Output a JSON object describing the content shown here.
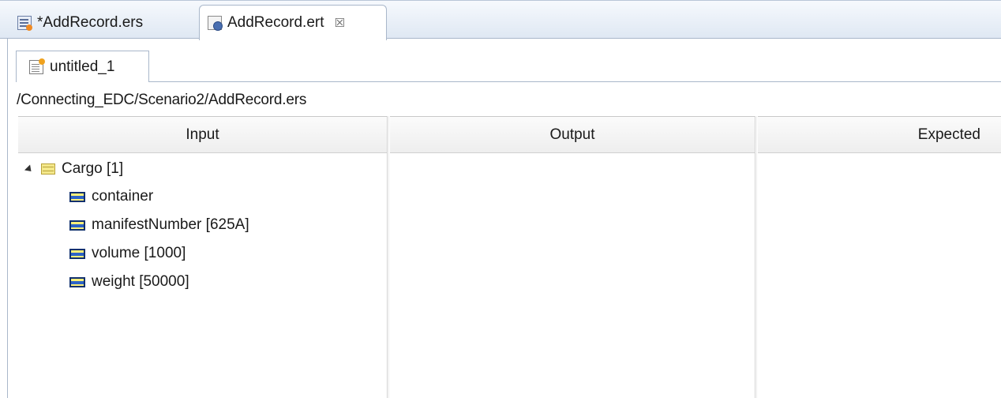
{
  "editor_tabs": [
    {
      "label": "*AddRecord.ers",
      "icon": "ers-file-icon",
      "active": false
    },
    {
      "label": "AddRecord.ert",
      "icon": "ert-file-icon",
      "active": true,
      "close_symbol": "☒"
    }
  ],
  "sub_tab": {
    "label": "untitled_1",
    "icon": "test-document-icon"
  },
  "path": "/Connecting_EDC/Scenario2/AddRecord.ers",
  "columns": {
    "input": "Input",
    "output": "Output",
    "expected": "Expected"
  },
  "tree": {
    "root": {
      "label": "Cargo [1]",
      "icon": "structure-icon",
      "expanded": true
    },
    "children": [
      {
        "label": "container",
        "icon": "field-icon"
      },
      {
        "label": "manifestNumber [625A]",
        "icon": "field-icon"
      },
      {
        "label": "volume [1000]",
        "icon": "field-icon"
      },
      {
        "label": "weight [50000]",
        "icon": "field-icon"
      }
    ]
  }
}
